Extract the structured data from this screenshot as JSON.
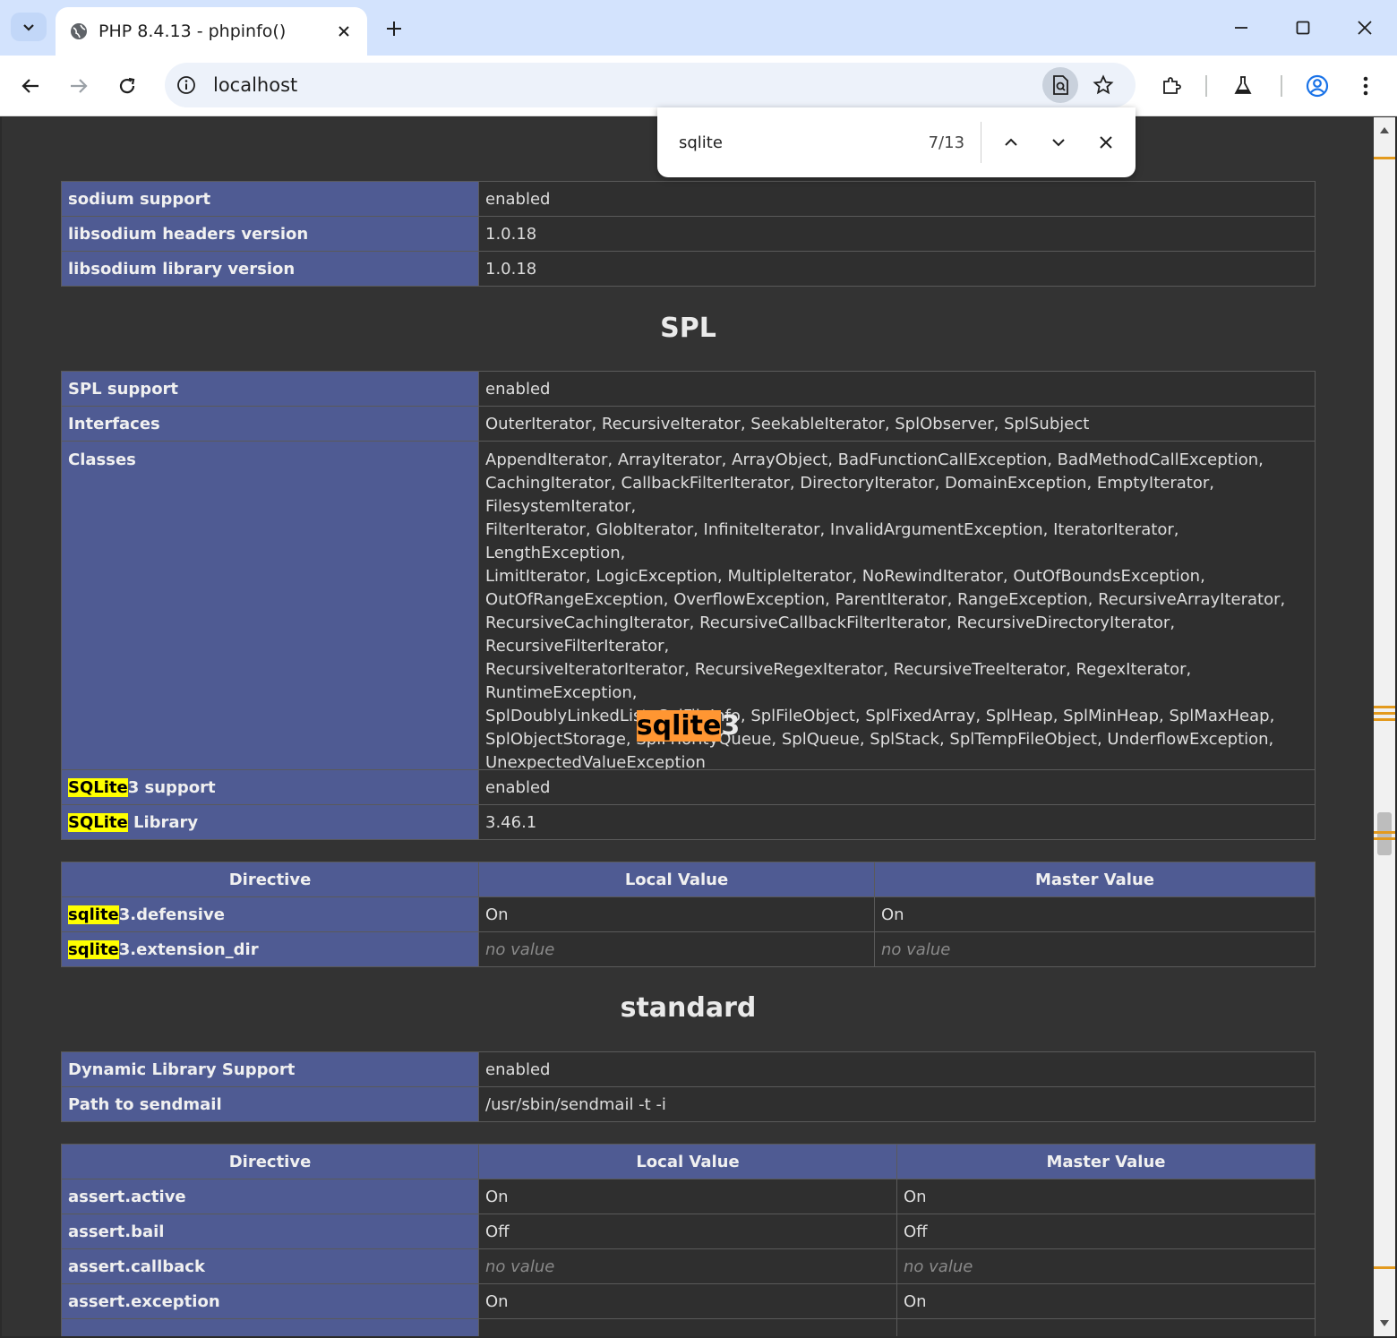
{
  "browser": {
    "tab_title": "PHP 8.4.13 - phpinfo()",
    "url": "localhost"
  },
  "find": {
    "query": "sqlite",
    "count": "7/13"
  },
  "sections": {
    "sodium": {
      "rows": [
        {
          "key": "sodium support",
          "value": "enabled"
        },
        {
          "key": "libsodium headers version",
          "value": "1.0.18"
        },
        {
          "key": "libsodium library version",
          "value": "1.0.18"
        }
      ]
    },
    "spl": {
      "title": "SPL",
      "rows": [
        {
          "key": "SPL support",
          "value": "enabled"
        },
        {
          "key": "Interfaces",
          "value": "OuterIterator, RecursiveIterator, SeekableIterator, SplObserver, SplSubject"
        },
        {
          "key": "Classes",
          "value": ""
        }
      ],
      "classes_lines": [
        "AppendIterator, ArrayIterator, ArrayObject, BadFunctionCallException, BadMethodCallException,",
        "CachingIterator, CallbackFilterIterator, DirectoryIterator, DomainException, EmptyIterator, FilesystemIterator,",
        "FilterIterator, GlobIterator, InfiniteIterator, InvalidArgumentException, IteratorIterator, LengthException,",
        "LimitIterator, LogicException, MultipleIterator, NoRewindIterator, OutOfBoundsException,",
        "OutOfRangeException, OverflowException, ParentIterator, RangeException, RecursiveArrayIterator,",
        "RecursiveCachingIterator, RecursiveCallbackFilterIterator, RecursiveDirectoryIterator, RecursiveFilterIterator,",
        "RecursiveIteratorIterator, RecursiveRegexIterator, RecursiveTreeIterator, RegexIterator, RuntimeException,",
        "SplDoublyLinkedList, SplFileInfo, SplFileObject, SplFixedArray, SplHeap, SplMinHeap, SplMaxHeap,",
        "SplObjectStorage, SplPriorityQueue, SplQueue, SplStack, SplTempFileObject, UnderflowException,",
        "UnexpectedValueException"
      ]
    },
    "sqlite3": {
      "title_match": "sqlite",
      "title_rest": "3",
      "rows": [
        {
          "key_match": "SQLite",
          "key_rest": "3 support",
          "value": "enabled"
        },
        {
          "key_match": "SQLite",
          "key_rest": " Library",
          "value": "3.46.1"
        }
      ],
      "directive_headers": [
        "Directive",
        "Local Value",
        "Master Value"
      ],
      "directives": [
        {
          "key_match": "sqlite",
          "key_rest": "3.defensive",
          "local": "On",
          "master": "On"
        },
        {
          "key_match": "sqlite",
          "key_rest": "3.extension_dir",
          "local": "no value",
          "master": "no value"
        }
      ]
    },
    "standard": {
      "title": "standard",
      "rows": [
        {
          "key": "Dynamic Library Support",
          "value": "enabled"
        },
        {
          "key": "Path to sendmail",
          "value": "/usr/sbin/sendmail -t -i"
        }
      ],
      "directive_headers": [
        "Directive",
        "Local Value",
        "Master Value"
      ],
      "directives": [
        {
          "key": "assert.active",
          "local": "On",
          "master": "On"
        },
        {
          "key": "assert.bail",
          "local": "Off",
          "master": "Off"
        },
        {
          "key": "assert.callback",
          "local": "no value",
          "master": "no value"
        },
        {
          "key": "assert.exception",
          "local": "On",
          "master": "On"
        }
      ]
    }
  },
  "icons": {
    "tab_dropdown": "chevron-down-icon",
    "favicon": "globe-icon",
    "back": "arrow-left-icon",
    "forward": "arrow-right-icon",
    "reload": "reload-icon",
    "site_info": "info-icon",
    "page_search": "zoom-page-icon",
    "bookmark": "star-icon",
    "extensions": "puzzle-icon",
    "labs": "flask-icon",
    "profile": "account-icon",
    "menu": "kebab-menu-icon"
  },
  "colors": {
    "header_cell": "#4f5b93",
    "page_bg": "#333333",
    "highlight": "#ffff00",
    "current_match": "#ff9632"
  }
}
